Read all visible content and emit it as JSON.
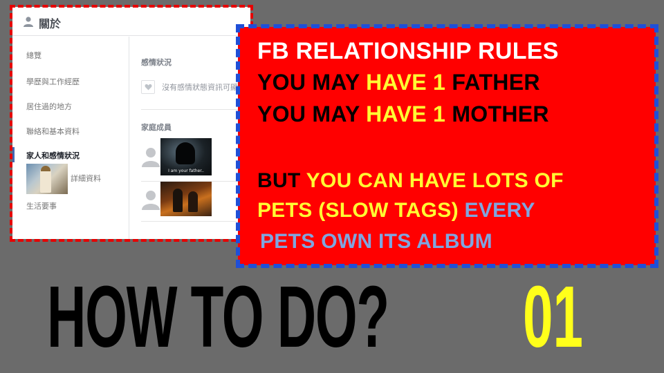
{
  "fb_about": {
    "header_title": "關於",
    "nav": [
      "總覽",
      "學歷與工作經歷",
      "居住過的地方",
      "聯絡和基本資料",
      "家人和感情狀況",
      "詳細資料",
      "生活要事"
    ],
    "relationship_title": "感情狀況",
    "relationship_text": "沒有感情狀態資訊可顯示",
    "family_title": "家庭成員",
    "vader_caption": "I am your father.."
  },
  "rules": {
    "line1": "FB  RELATIONSHIP  RULES",
    "line2_a": "YOU MAY ",
    "line2_b": "HAVE 1",
    "line2_c": " FATHER",
    "line3_a": "YOU MAY ",
    "line3_b": "HAVE 1",
    "line3_c": " MOTHER",
    "line4_a": "BUT ",
    "line4_b": "YOU CAN HAVE LOTS OF",
    "line5_a": "PETS (SLOW TAGS) ",
    "line5_b": "EVERY",
    "line6": "PETS OWN ITS ALBUM"
  },
  "title": {
    "main": "HOW TO DO?",
    "number": "01"
  },
  "colors": {
    "background": "#6b6b6b",
    "box_red": "#ff0000",
    "dash_blue": "#1f4fd8",
    "accent_yellow": "#ffff33",
    "accent_blue": "#7fa6e0"
  }
}
